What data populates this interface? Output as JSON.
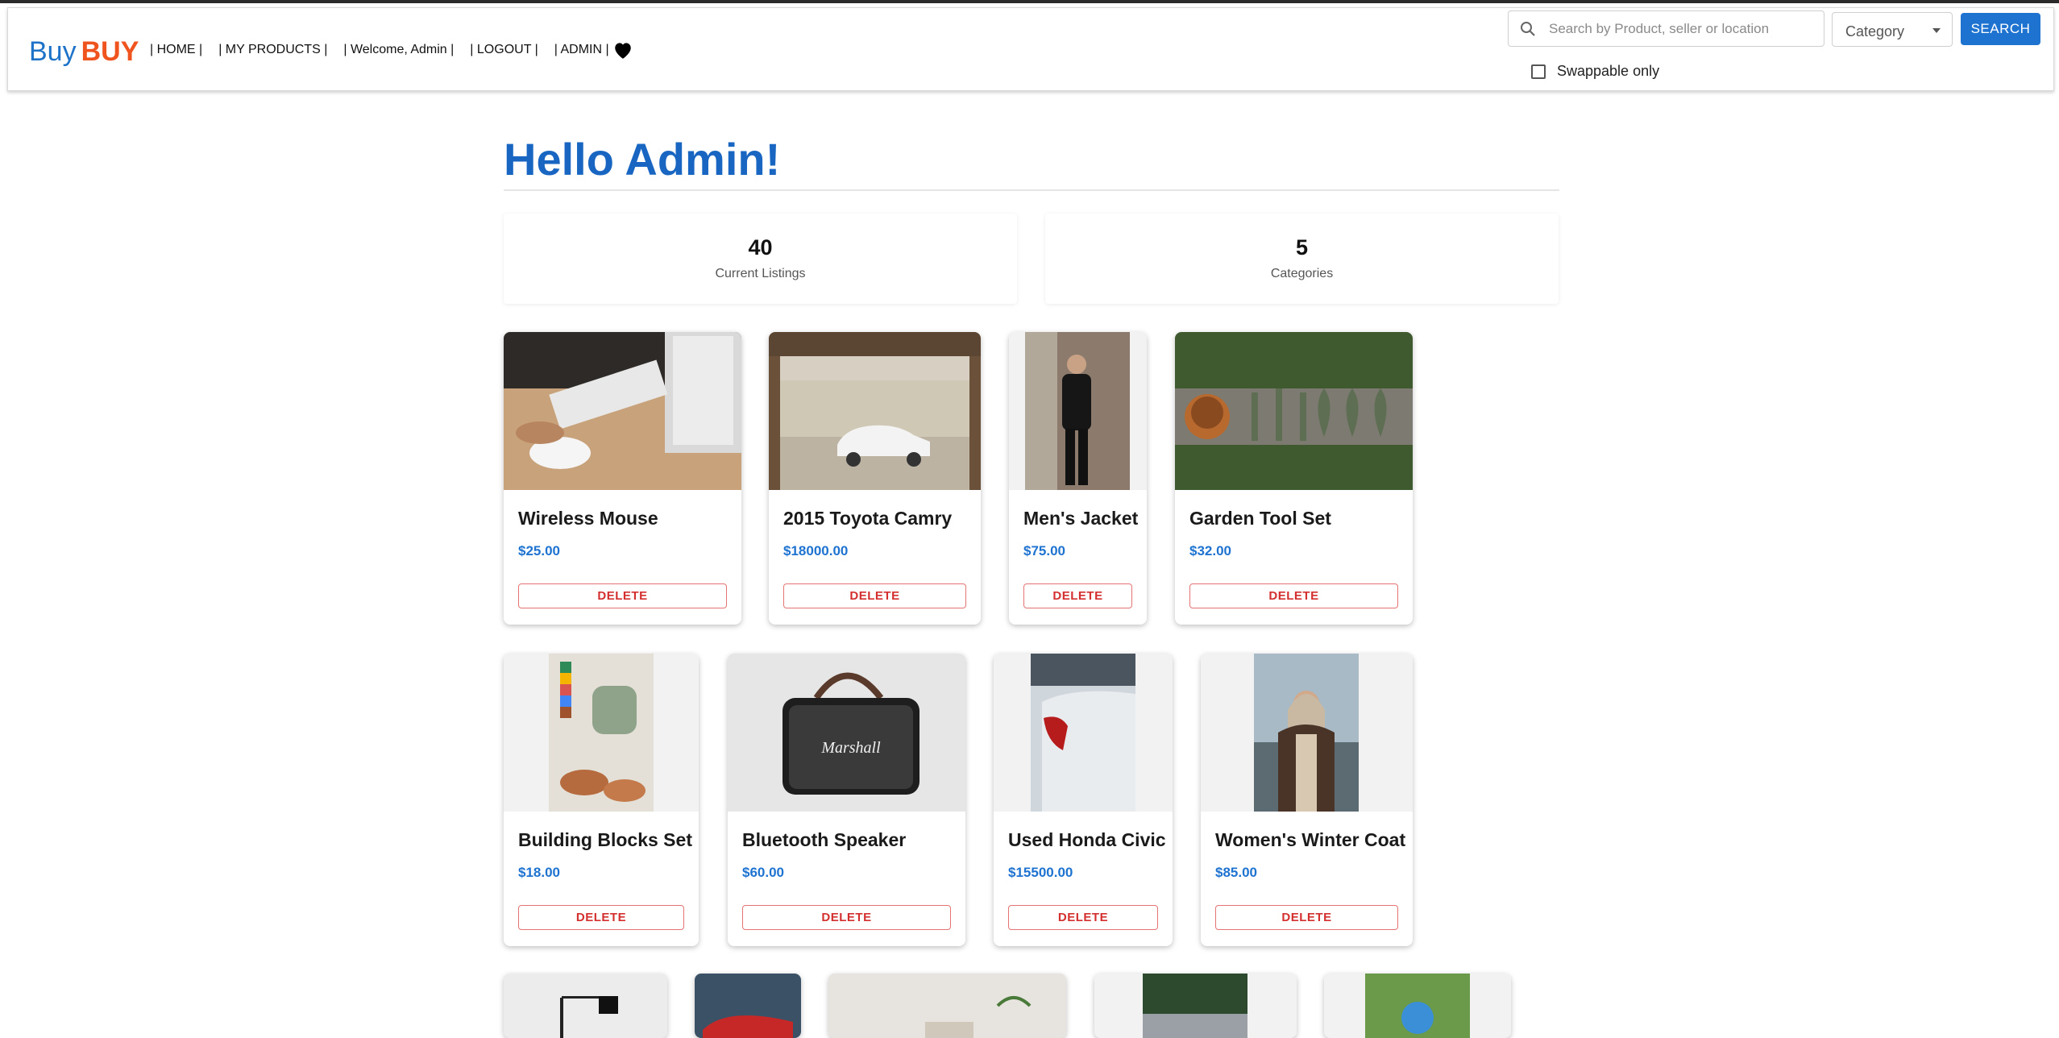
{
  "brand": {
    "part1": "Buy",
    "part2": "BUY",
    "color_primary": "#1e73c8",
    "color_accent": "#f0541e"
  },
  "nav": {
    "home": "| HOME |",
    "my_products": "| MY PRODUCTS |",
    "welcome": "| Welcome, Admin |",
    "logout": "| LOGOUT |",
    "admin": "| ADMIN |",
    "favorites_icon": "heart-icon"
  },
  "search": {
    "placeholder": "Search by Product, seller or location",
    "category_label": "Category",
    "button_label": "SEARCH",
    "swappable_label": "Swappable only"
  },
  "main": {
    "greeting": "Hello Admin!",
    "stats": [
      {
        "value": "40",
        "label": "Current Listings"
      },
      {
        "value": "5",
        "label": "Categories"
      }
    ]
  },
  "products": [
    {
      "title": "Wireless Mouse",
      "price": "$25.00",
      "action": "DELETE"
    },
    {
      "title": "2015 Toyota Camry",
      "price": "$18000.00",
      "action": "DELETE"
    },
    {
      "title": "Men's Jacket",
      "price": "$75.00",
      "action": "DELETE"
    },
    {
      "title": "Garden Tool Set",
      "price": "$32.00",
      "action": "DELETE"
    },
    {
      "title": "Building Blocks Set",
      "price": "$18.00",
      "action": "DELETE"
    },
    {
      "title": "Bluetooth Speaker",
      "price": "$60.00",
      "action": "DELETE"
    },
    {
      "title": "Used Honda Civic",
      "price": "$15500.00",
      "action": "DELETE"
    },
    {
      "title": "Women's Winter Coat",
      "price": "$85.00",
      "action": "DELETE"
    }
  ],
  "colors": {
    "heading": "#1866c1",
    "price": "#1e73d1",
    "delete": "#d32f2f",
    "search_button": "#1e73d1"
  }
}
